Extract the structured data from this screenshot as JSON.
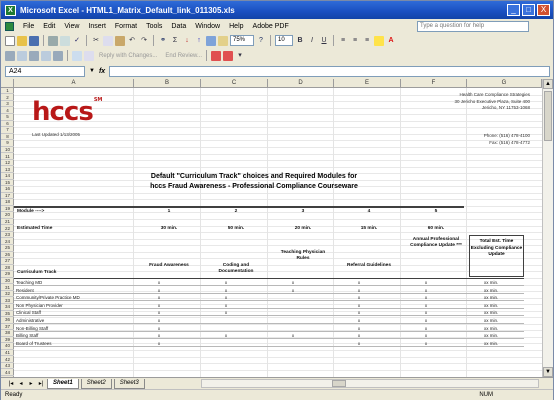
{
  "window": {
    "title": "Microsoft Excel - HTML1_Matrix_Default_link_011305.xls",
    "buttons": [
      "_",
      "□",
      "X"
    ]
  },
  "menu": [
    "File",
    "Edit",
    "View",
    "Insert",
    "Format",
    "Tools",
    "Data",
    "Window",
    "Help",
    "Adobe PDF"
  ],
  "help_placeholder": "Type a question for help",
  "toolbar": {
    "zoom": "75%",
    "font_size": "10",
    "reply_label": "Reply with Changes...",
    "end_review_label": "End Review..."
  },
  "formula_bar": {
    "name_box": "A24",
    "fx": "fx",
    "value": ""
  },
  "columns": [
    "A",
    "B",
    "C",
    "D",
    "E",
    "F",
    "G"
  ],
  "rows": [
    "1",
    "2",
    "3",
    "4",
    "5",
    "6",
    "7",
    "8",
    "9",
    "10",
    "11",
    "12",
    "13",
    "14",
    "15",
    "16",
    "17",
    "18",
    "19",
    "20",
    "21",
    "22",
    "23",
    "24",
    "25",
    "26",
    "27",
    "28",
    "29",
    "30",
    "31",
    "32",
    "33",
    "34",
    "35",
    "36",
    "37",
    "38",
    "39",
    "40",
    "41",
    "42",
    "43",
    "44"
  ],
  "sheet": {
    "logo": "hccs",
    "logo_mark": "SM",
    "updated": "Last Updated 1/13/2005",
    "address": [
      "Health Care Compliance Strategies",
      "30 Jericho Executive Plaza, Suite 400",
      "Jericho, NY  11753-1068"
    ],
    "contact": [
      "Phone: (516) 478-4100",
      "Fax: (516) 478-4772"
    ],
    "heading_line1": "Default \"Curriculum Track\" choices and Required Modules for",
    "heading_line2": "hccs Fraud Awareness - Professional Compliance Courseware",
    "module_label": "Module ---->",
    "modules": [
      "1",
      "2",
      "3",
      "4",
      "5"
    ],
    "estimated_time_label": "Estimated Time",
    "times": [
      "30 min.",
      "50 min.",
      "20 min.",
      "15 min.",
      "60 min."
    ],
    "module_names": [
      "Fraud Awareness",
      "Coding and Documentation",
      "Teaching Physician Rules",
      "Referral Guidelines",
      "Annual Professional Compliance Update ***"
    ],
    "curriculum_track_label": "Curriculum Track",
    "total_box": "Total Est. Time Excluding Compliance Update",
    "tracks": [
      {
        "name": "Teaching MD",
        "marks": [
          "x",
          "x",
          "x",
          "x",
          "x"
        ],
        "total": "xx min."
      },
      {
        "name": "Resident",
        "marks": [
          "x",
          "x",
          "x",
          "x",
          "x"
        ],
        "total": "xx min."
      },
      {
        "name": "Community/Private Practice MD",
        "marks": [
          "x",
          "x",
          "",
          "x",
          "x"
        ],
        "total": "xx min."
      },
      {
        "name": "Non Physician Provider",
        "marks": [
          "x",
          "x",
          "",
          "x",
          "x"
        ],
        "total": "xx min."
      },
      {
        "name": "Clinical Staff",
        "marks": [
          "x",
          "x",
          "",
          "x",
          "x"
        ],
        "total": "xx min."
      },
      {
        "name": "Administrative",
        "marks": [
          "x",
          "",
          "",
          "x",
          "x"
        ],
        "total": "xx min."
      },
      {
        "name": "Non-Billing Staff",
        "marks": [
          "x",
          "",
          "",
          "x",
          "x"
        ],
        "total": "xx min."
      },
      {
        "name": "Billing Staff",
        "marks": [
          "x",
          "x",
          "x",
          "x",
          "x"
        ],
        "total": "xx min."
      },
      {
        "name": "Board of Trustees",
        "marks": [
          "x",
          "",
          "",
          "x",
          "x"
        ],
        "total": "xx min."
      }
    ]
  },
  "tabs": [
    "Sheet1",
    "Sheet2",
    "Sheet3"
  ],
  "status": {
    "left": "Ready",
    "right": "NUM"
  }
}
